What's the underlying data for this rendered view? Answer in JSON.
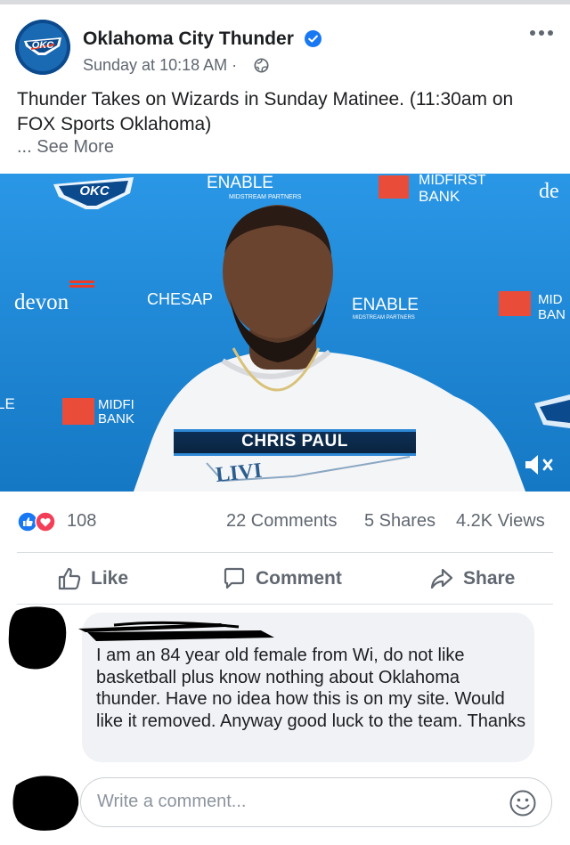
{
  "post": {
    "page_name": "Oklahoma City Thunder",
    "avatar_text": "OKC",
    "time": "Sunday at 10:18 AM ·",
    "text": "Thunder Takes on Wizards in Sunday Matinee. (11:30am on FOX Sports Oklahoma)",
    "see_more": "... See More"
  },
  "video": {
    "lower_third_name": "CHRIS PAUL",
    "backdrop_logos": [
      "OKC",
      "ENABLE",
      "MIDSTREAM PARTNERS",
      "MIDFIRST",
      "BANK",
      "devon",
      "CHESAP",
      "ENABLE",
      "MIDSTREAM PARTNERS",
      "MID",
      "BAN",
      "MIDFI",
      "BANK",
      "de",
      "LE"
    ],
    "shirt_text": "LIVI",
    "muted": true
  },
  "stats": {
    "reactions": "108",
    "comments": "22 Comments",
    "shares": "5 Shares",
    "views": "4.2K Views"
  },
  "actions": {
    "like": "Like",
    "comment": "Comment",
    "share": "Share"
  },
  "comment": {
    "author_redacted": true,
    "text": "I am an 84 year old female from Wi, do not like basketball plus know nothing about Oklahoma thunder. Have no idea how this is on my site. Would like it removed. Anyway good luck to the team. Thanks"
  },
  "composer": {
    "placeholder": "Write a comment..."
  },
  "icons": {
    "verified": "verified-badge-icon",
    "audience": "globe-icon",
    "more": "more-options-icon",
    "like": "thumbs-up-icon",
    "comment": "speech-bubble-icon",
    "share": "share-arrow-icon",
    "mute": "speaker-muted-icon",
    "emoji": "smiley-icon"
  },
  "colors": {
    "facebook_blue": "#1877f2",
    "love_red": "#f33e58",
    "thunder_blue": "#007ac1",
    "thunder_orange": "#ef3b24",
    "secondary_text": "#606770"
  }
}
